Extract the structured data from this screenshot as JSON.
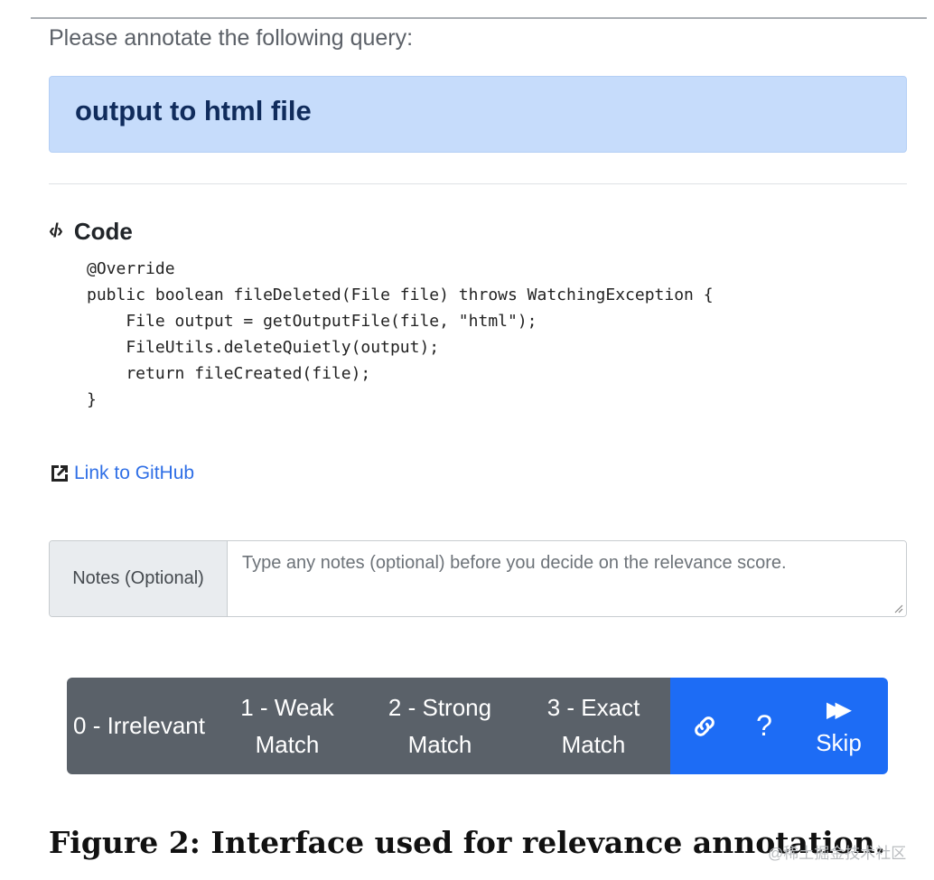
{
  "prompt": "Please annotate the following query:",
  "query": "output to html file",
  "code": {
    "icon": "code-icon",
    "title": "Code",
    "source": "@Override\npublic boolean fileDeleted(File file) throws WatchingException {\n    File output = getOutputFile(file, \"html\");\n    FileUtils.deleteQuietly(output);\n    return fileCreated(file);\n}"
  },
  "github_link": {
    "icon": "external-link-icon",
    "label": "Link to GitHub"
  },
  "notes": {
    "label": "Notes (Optional)",
    "value": "",
    "placeholder": "Type any notes (optional) before you decide on the relevance score."
  },
  "buttons": {
    "irrelevant": "0 - Irrelevant",
    "weak": "1 - Weak Match",
    "strong": "2 - Strong Match",
    "exact": "3 - Exact Match",
    "link_icon": "link-icon",
    "help": "?",
    "skip_icon": "fast-forward-icon",
    "skip": "Skip"
  },
  "caption": "Figure 2: Interface used for relevance annotation.",
  "watermark": "@稀土掘金技术社区",
  "colors": {
    "query_bg": "#c6dcfb",
    "query_text": "#102c5c",
    "btn_grey": "#5a6169",
    "btn_blue": "#1d6cf5",
    "link": "#2f6fe6"
  }
}
